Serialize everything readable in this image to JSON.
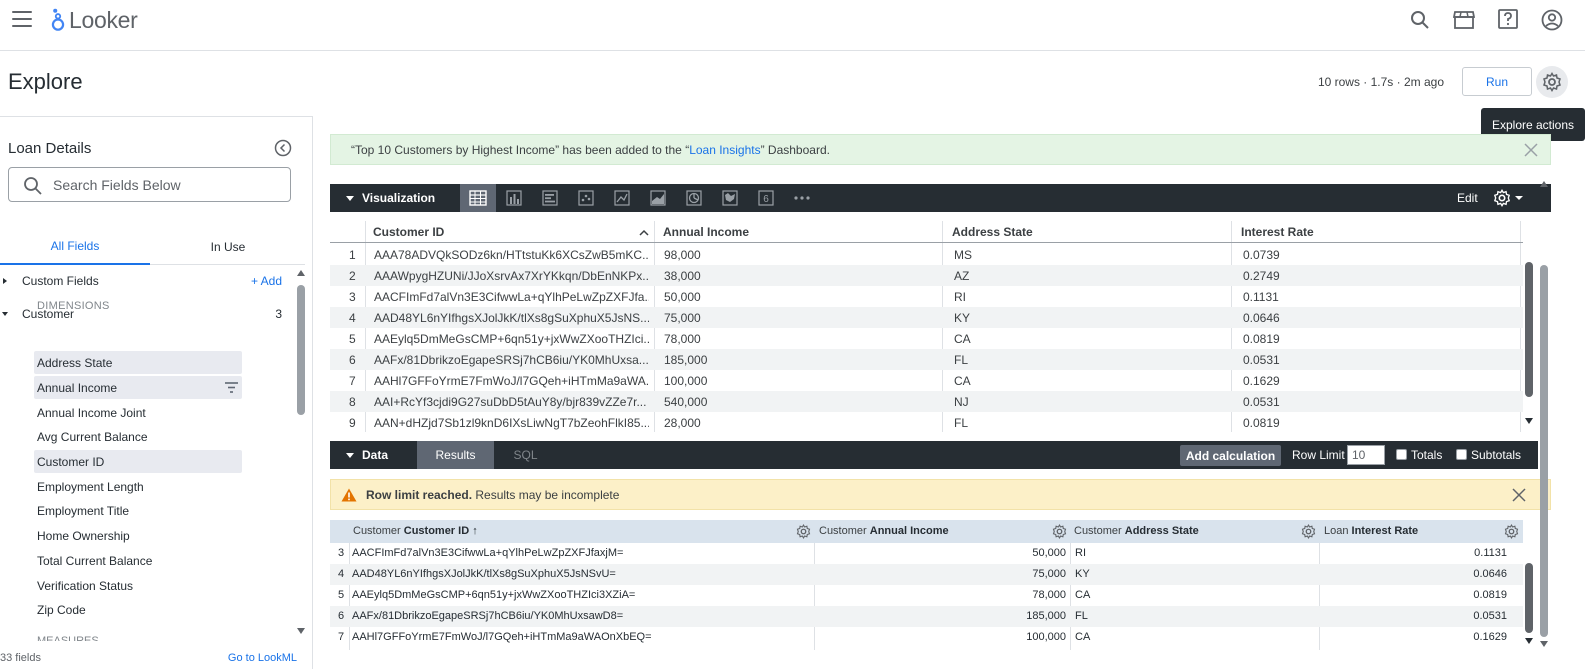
{
  "app": {
    "name": "Looker"
  },
  "header": {
    "title": "Explore",
    "run_meta": "10 rows · 1.7s · 2m ago",
    "run_label": "Run",
    "tooltip": "Explore actions"
  },
  "sidebar": {
    "title": "Loan Details",
    "search_placeholder": "Search Fields Below",
    "tabs": [
      "All Fields",
      "In Use"
    ],
    "custom_fields": {
      "label": "Custom Fields",
      "add": "+ Add"
    },
    "customer": {
      "label": "Customer",
      "count": "3"
    },
    "dimensions_label": "DIMENSIONS",
    "fields": [
      "Address State",
      "Annual Income",
      "Annual Income Joint",
      "Avg Current Balance",
      "Customer ID",
      "Employment Length",
      "Employment Title",
      "Home Ownership",
      "Total Current Balance",
      "Verification Status",
      "Zip Code"
    ],
    "measures_label": "MEASURES",
    "field_count": "33 fields",
    "goto_lookml": "Go to LookML"
  },
  "banner": {
    "prefix": "“Top 10 Customers by Highest Income” has been added to the “",
    "link": "Loan Insights",
    "suffix": "” Dashboard."
  },
  "visualization": {
    "title": "Visualization",
    "edit": "Edit",
    "icons": [
      "table-icon",
      "bar-chart-icon",
      "column-chart-icon",
      "scatter-icon",
      "line-chart-icon",
      "area-chart-icon",
      "pie-chart-icon",
      "map-icon",
      "single-value-icon",
      "more-icon"
    ],
    "columns": [
      "Customer ID",
      "Annual Income",
      "Address State",
      "Interest Rate"
    ],
    "rows": [
      [
        "1",
        "AAA78ADVQkSODz6kn/HTtstuKk6XCsZwB5mKC...",
        "98,000",
        "MS",
        "0.0739"
      ],
      [
        "2",
        "AAAWpygHZUNi/JJoXsrvAx7XrYKkqn/DbEnNKPx...",
        "38,000",
        "AZ",
        "0.2749"
      ],
      [
        "3",
        "AACFImFd7alVn3E3CifwwLa+qYlhPeLwZpZXFJfa...",
        "50,000",
        "RI",
        "0.1131"
      ],
      [
        "4",
        "AAD48YL6nYIfhgsXJolJkK/tlXs8gSuXphuX5JsNS...",
        "75,000",
        "KY",
        "0.0646"
      ],
      [
        "5",
        "AAEylq5DmMeGsCMP+6qn51y+jxWwZXooTHZIci...",
        "78,000",
        "CA",
        "0.0819"
      ],
      [
        "6",
        "AAFx/81DbrikzoEgapeSRSj7hCB6iu/YK0MhUxsa...",
        "185,000",
        "FL",
        "0.0531"
      ],
      [
        "7",
        "AAHl7GFFoYrmE7FmWoJ/l7GQeh+iHTmMa9aWA...",
        "100,000",
        "CA",
        "0.1629"
      ],
      [
        "8",
        "AAI+RcYf3cjdi9G27suDbD5tAuY8y/bjr839vZZe7r...",
        "540,000",
        "NJ",
        "0.0531"
      ],
      [
        "9",
        "AAN+dHZjd7Sb1zl9knD6IXsLiwNgT7bZeohFlkI85...",
        "28,000",
        "FL",
        "0.0819"
      ]
    ]
  },
  "data_panel": {
    "title": "Data",
    "tabs": [
      "Results",
      "SQL"
    ],
    "add_calculation": "Add calculation",
    "row_limit_label": "Row Limit",
    "row_limit_value": "10",
    "totals": "Totals",
    "subtotals": "Subtotals"
  },
  "warning": {
    "bold": "Row limit reached.",
    "text": " Results may be incomplete"
  },
  "results": {
    "columns": [
      {
        "view": "Customer ",
        "field": "Customer ID ↑"
      },
      {
        "view": "Customer ",
        "field": "Annual Income"
      },
      {
        "view": "Customer ",
        "field": "Address State"
      },
      {
        "view": "Loan ",
        "field": "Interest Rate"
      }
    ],
    "rows": [
      [
        "3",
        "AACFImFd7alVn3E3CifwwLa+qYlhPeLwZpZXFJfaxjM=",
        "50,000",
        "RI",
        "0.1131"
      ],
      [
        "4",
        "AAD48YL6nYIfhgsXJolJkK/tlXs8gSuXphuX5JsNSvU=",
        "75,000",
        "KY",
        "0.0646"
      ],
      [
        "5",
        "AAEylq5DmMeGsCMP+6qn51y+jxWwZXooTHZIci3XZiA=",
        "78,000",
        "CA",
        "0.0819"
      ],
      [
        "6",
        "AAFx/81DbrikzoEgapeSRSj7hCB6iu/YK0MhUxsawD8=",
        "185,000",
        "FL",
        "0.0531"
      ],
      [
        "7",
        "AAHl7GFFoYrmE7FmWoJ/l7GQeh+iHTmMa9aWAOnXbEQ=",
        "100,000",
        "CA",
        "0.1629"
      ]
    ]
  },
  "colors": {
    "accent": "#1a73e8",
    "dark_bar": "#262d33",
    "success_bg": "#e4f4e4",
    "warning_bg": "#fcf0c8"
  }
}
